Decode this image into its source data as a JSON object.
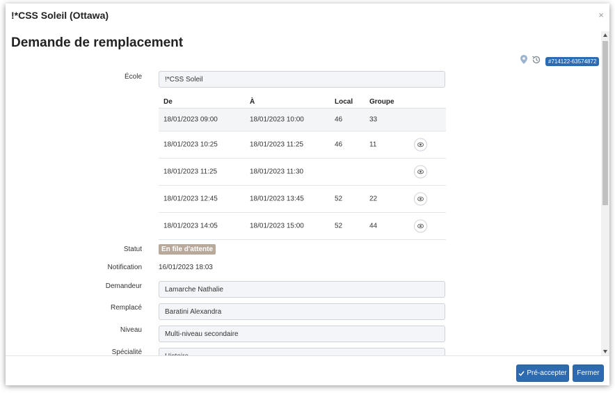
{
  "window": {
    "title": "!*CSS Soleil (Ottawa)",
    "close_label": "×"
  },
  "page": {
    "title": "Demande de remplacement"
  },
  "top_icons": {
    "location_icon": "map-pin-icon",
    "history_icon": "history-icon",
    "id_badge": "#714122-63574872"
  },
  "labels": {
    "ecole": "École",
    "statut": "Statut",
    "notification": "Notification",
    "demandeur": "Demandeur",
    "remplace": "Remplacé",
    "niveau": "Niveau",
    "specialite": "Spécialité"
  },
  "fields": {
    "ecole": "!*CSS Soleil",
    "demandeur": "Lamarche Nathalie",
    "remplace": "Baratini Alexandra",
    "niveau": "Multi-niveau secondaire",
    "specialite": "Histoire"
  },
  "table": {
    "headers": [
      "De",
      "À",
      "Local",
      "Groupe"
    ],
    "rows": [
      {
        "de": "18/01/2023 09:00",
        "a": "18/01/2023 10:00",
        "local": "46",
        "groupe": "33",
        "eye": false
      },
      {
        "de": "18/01/2023 10:25",
        "a": "18/01/2023 11:25",
        "local": "46",
        "groupe": "11",
        "eye": true
      },
      {
        "de": "18/01/2023 11:25",
        "a": "18/01/2023 11:30",
        "local": "",
        "groupe": "",
        "eye": true
      },
      {
        "de": "18/01/2023 12:45",
        "a": "18/01/2023 13:45",
        "local": "52",
        "groupe": "22",
        "eye": true
      },
      {
        "de": "18/01/2023 14:05",
        "a": "18/01/2023 15:00",
        "local": "52",
        "groupe": "44",
        "eye": true
      }
    ]
  },
  "status": {
    "label": "En file d'attente",
    "color": "#b8a99a"
  },
  "notification": {
    "value": "16/01/2023 18:03"
  },
  "footer": {
    "preaccept_label": "Pré-accepter",
    "preaccept_icon": "check-icon",
    "close_label": "Fermer"
  },
  "colors": {
    "primary": "#2e6ab0"
  }
}
